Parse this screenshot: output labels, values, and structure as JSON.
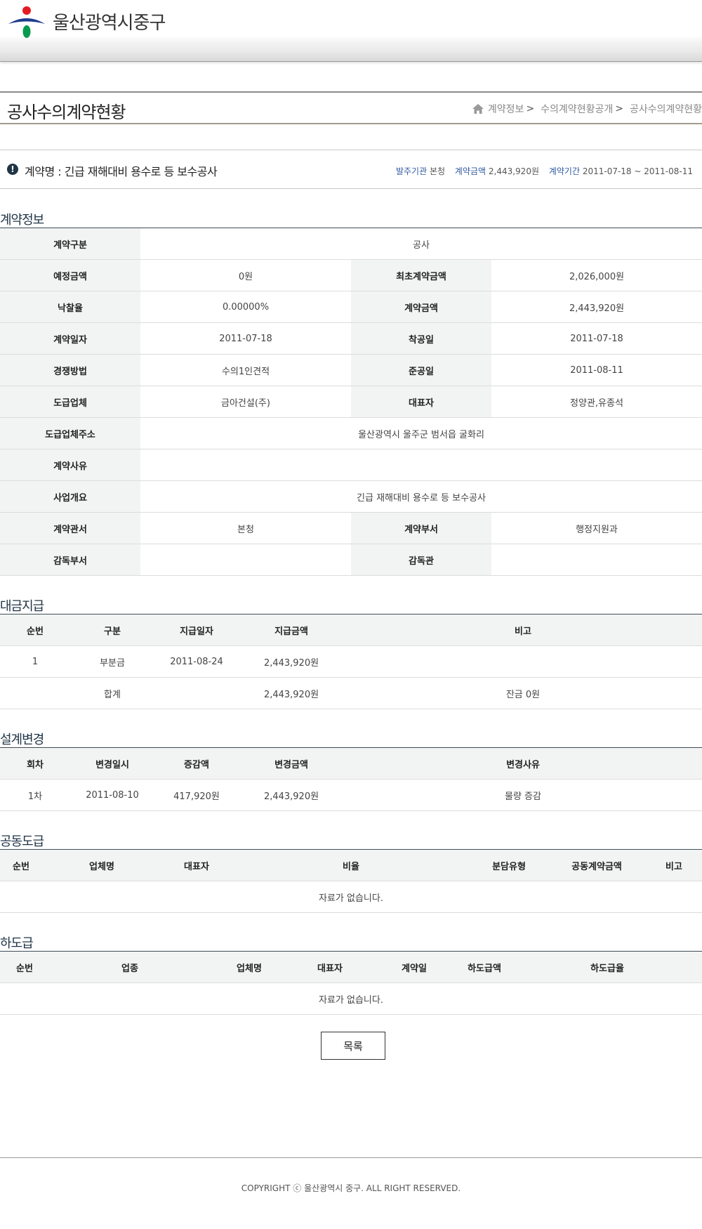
{
  "header": {
    "site_name": "울산광역시중구"
  },
  "page": {
    "title": "공사수의계약현황",
    "breadcrumb": [
      "계약정보",
      "수의계약현황공개",
      "공사수의계약현황"
    ],
    "breadcrumb_sep": ">"
  },
  "summary": {
    "alert_glyph": "!",
    "contract_label": "계약명 : ",
    "contract_name": "긴급 재해대비 용수로 등 보수공사",
    "agency_label": "발주기관",
    "agency": "본청",
    "amount_label": "계약금액",
    "amount": "2,443,920원",
    "period_label": "계약기간",
    "period": "2011-07-18 ~ 2011-08-11"
  },
  "contract_info": {
    "title": "계약정보",
    "contract_type_label": "계약구분",
    "contract_type": "공사",
    "estimated_label": "예정금액",
    "estimated": "0원",
    "initial_amount_label": "최초계약금액",
    "initial_amount": "2,026,000원",
    "bid_rate_label": "낙찰율",
    "bid_rate": "0.00000%",
    "contract_amount_label": "계약금액",
    "contract_amount": "2,443,920원",
    "contract_date_label": "계약일자",
    "contract_date": "2011-07-18",
    "start_date_label": "착공일",
    "start_date": "2011-07-18",
    "method_label": "경쟁방법",
    "method": "수의1인견적",
    "completion_label": "준공일",
    "completion": "2011-08-11",
    "contractor_label": "도급업체",
    "contractor": "금아건설(주)",
    "representative_label": "대표자",
    "representative": "정양관,유종석",
    "address_label": "도급업체주소",
    "address": "울산광역시 울주군 범서읍 굴화리",
    "reason_label": "계약사유",
    "reason": "",
    "overview_label": "사업개요",
    "overview": "긴급 재해대비 용수로 등 보수공사",
    "office_label": "계약관서",
    "office": "본청",
    "department_label": "계약부서",
    "department": "행정지원과",
    "supervise_dept_label": "감독부서",
    "supervise_dept": "",
    "supervisor_label": "감독관",
    "supervisor": ""
  },
  "payments": {
    "title": "대금지급",
    "headers": [
      "순번",
      "구분",
      "지급일자",
      "지급금액",
      "비고"
    ],
    "rows": [
      {
        "no": "1",
        "type": "부분금",
        "date": "2011-08-24",
        "amount": "2,443,920원",
        "note": ""
      }
    ],
    "total": {
      "label": "합계",
      "amount": "2,443,920원",
      "note": "잔금 0원"
    }
  },
  "design_changes": {
    "title": "설계변경",
    "headers": [
      "회차",
      "변경일시",
      "증감액",
      "변경금액",
      "변경사유"
    ],
    "rows": [
      {
        "round": "1차",
        "date": "2011-08-10",
        "delta": "417,920원",
        "amount": "2,443,920원",
        "reason": "물량 증감"
      }
    ]
  },
  "joint": {
    "title": "공동도급",
    "headers": [
      "순번",
      "업체명",
      "대표자",
      "비율",
      "분담유형",
      "공동계약금액",
      "비고"
    ],
    "empty": "자료가 없습니다."
  },
  "subcontract": {
    "title": "하도급",
    "headers": [
      "순번",
      "업종",
      "업체명",
      "대표자",
      "계약일",
      "하도급액",
      "하도급율"
    ],
    "empty": "자료가 없습니다."
  },
  "actions": {
    "list_label": "목록"
  },
  "footer": {
    "copyright": "COPYRIGHT ⓒ 울산광역시 중구. ALL RIGHT RESERVED."
  },
  "colors": {
    "navy": "#1f3446",
    "link_blue": "#2f5aa2",
    "label_bg": "#f2f4f3",
    "logo_red": "#e31c23",
    "logo_blue": "#1e3d8f",
    "logo_green": "#0a9a4e"
  }
}
